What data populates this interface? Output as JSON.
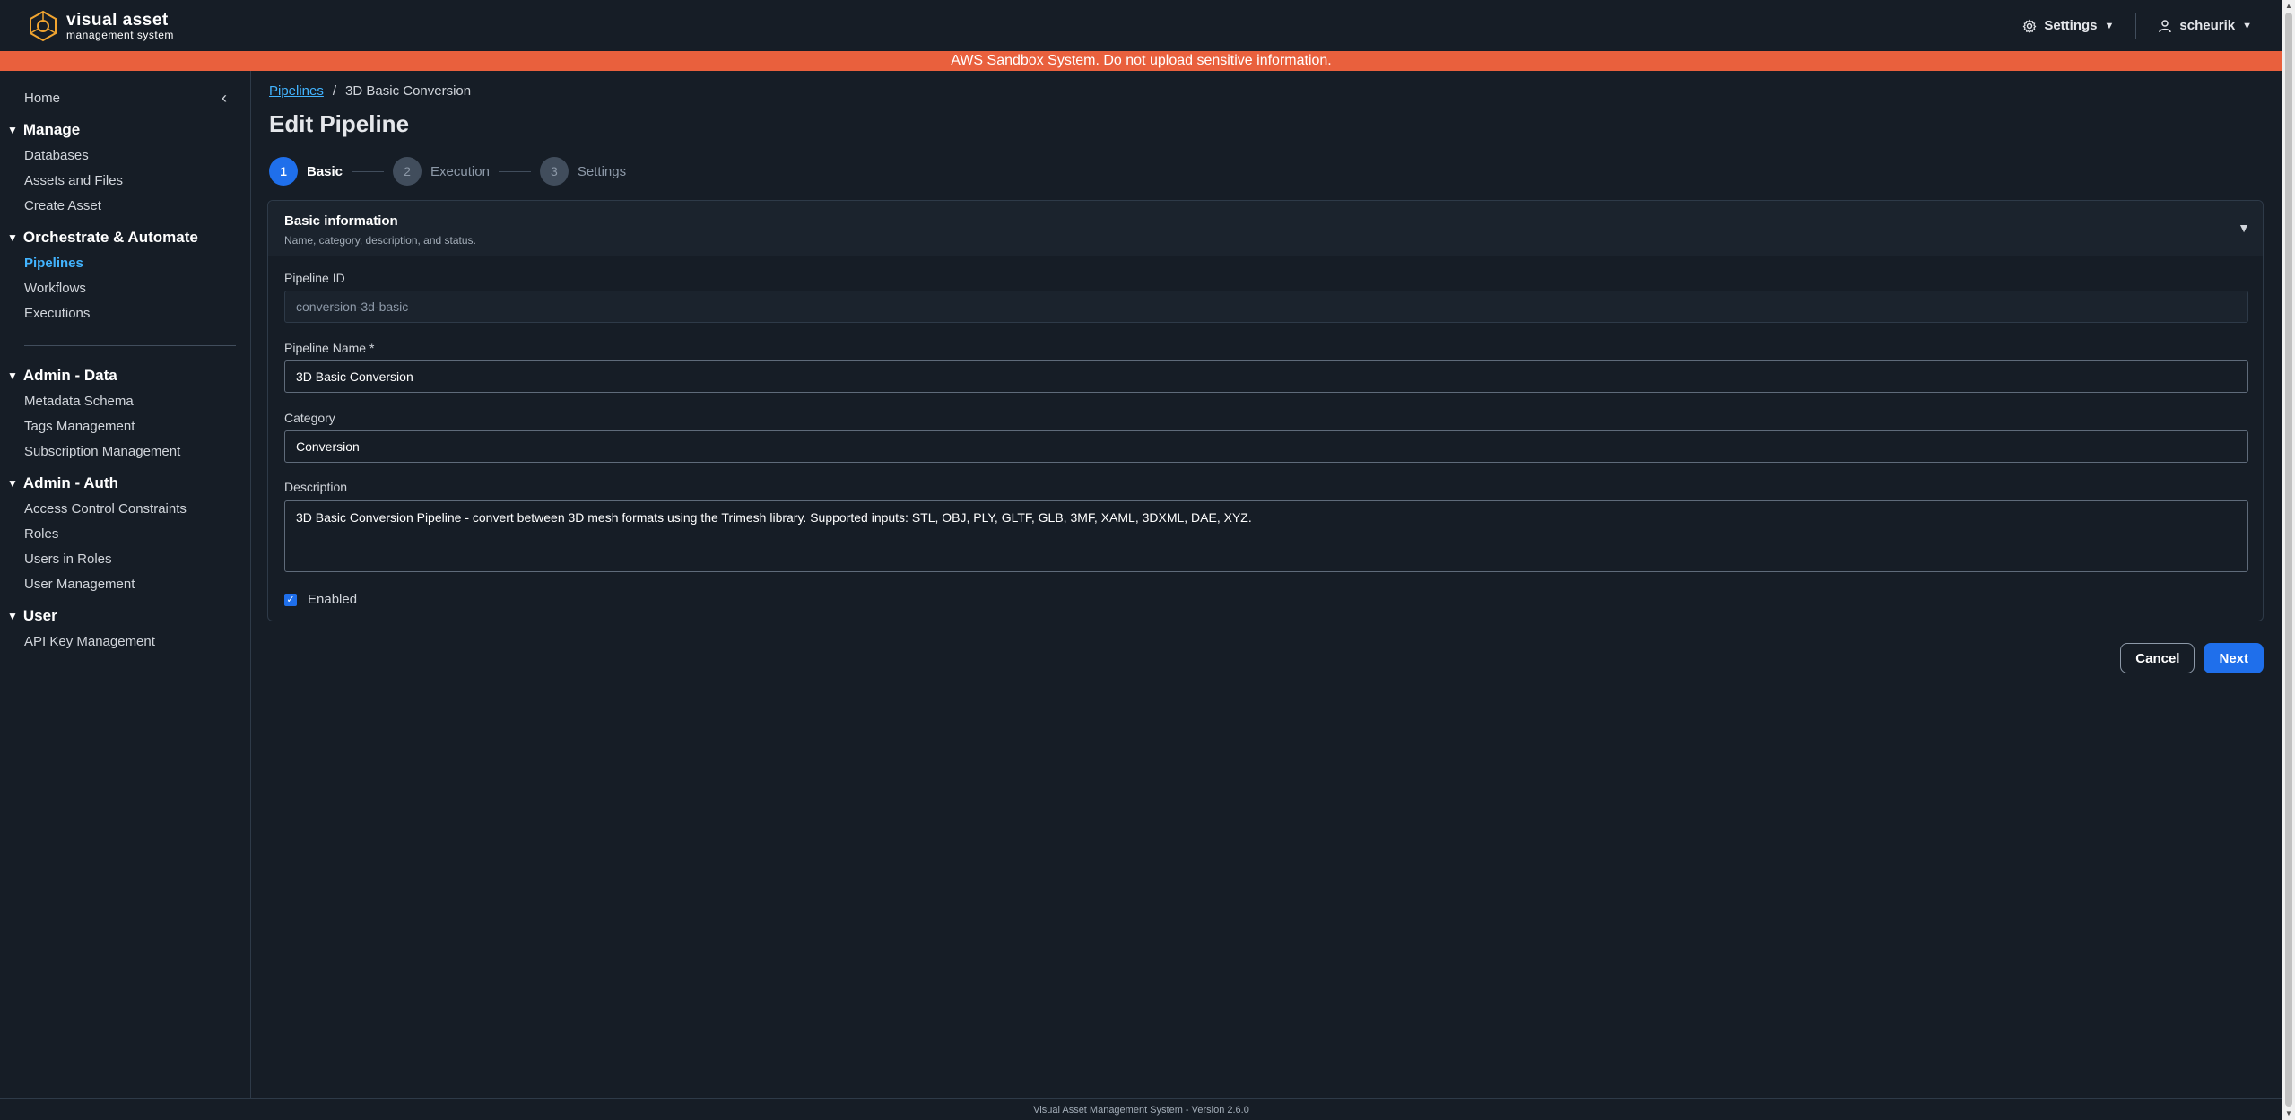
{
  "brand": {
    "title": "visual asset",
    "subtitle": "management system"
  },
  "topnav": {
    "settings_label": "Settings",
    "user_label": "scheurik"
  },
  "banner": {
    "text": "AWS Sandbox System. Do not upload sensitive information."
  },
  "sidebar": {
    "home": "Home",
    "sections": [
      {
        "title": "Manage",
        "items": [
          "Databases",
          "Assets and Files",
          "Create Asset"
        ]
      },
      {
        "title": "Orchestrate & Automate",
        "items": [
          "Pipelines",
          "Workflows",
          "Executions"
        ]
      },
      {
        "title": "Admin - Data",
        "items": [
          "Metadata Schema",
          "Tags Management",
          "Subscription Management"
        ]
      },
      {
        "title": "Admin - Auth",
        "items": [
          "Access Control Constraints",
          "Roles",
          "Users in Roles",
          "User Management"
        ]
      },
      {
        "title": "User",
        "items": [
          "API Key Management"
        ]
      }
    ],
    "active_item": "Pipelines"
  },
  "breadcrumb": {
    "parent": "Pipelines",
    "separator": "/",
    "current": "3D Basic Conversion"
  },
  "page_title": "Edit Pipeline",
  "steps": [
    {
      "num": "1",
      "label": "Basic",
      "active": true
    },
    {
      "num": "2",
      "label": "Execution",
      "active": false
    },
    {
      "num": "3",
      "label": "Settings",
      "active": false
    }
  ],
  "panel": {
    "title": "Basic information",
    "description": "Name, category, description, and status."
  },
  "form": {
    "pipeline_id": {
      "label": "Pipeline ID",
      "value": "conversion-3d-basic"
    },
    "pipeline_name": {
      "label": "Pipeline Name *",
      "value": "3D Basic Conversion"
    },
    "category": {
      "label": "Category",
      "value": "Conversion"
    },
    "description": {
      "label": "Description",
      "value": "3D Basic Conversion Pipeline - convert between 3D mesh formats using the Trimesh library. Supported inputs: STL, OBJ, PLY, GLTF, GLB, 3MF, XAML, 3DXML, DAE, XYZ."
    },
    "enabled": {
      "label": "Enabled",
      "checked": true
    }
  },
  "actions": {
    "cancel": "Cancel",
    "next": "Next"
  },
  "footer": {
    "text": "Visual Asset Management System - Version 2.6.0"
  },
  "colors": {
    "accent": "#1f6feb",
    "link": "#42b4ff",
    "banner": "#e9603d",
    "background": "#161d26"
  },
  "icons": {
    "logo": "vams-logo-icon",
    "settings": "gear-icon",
    "user": "user-icon",
    "collapse": "chevron-left-icon"
  }
}
